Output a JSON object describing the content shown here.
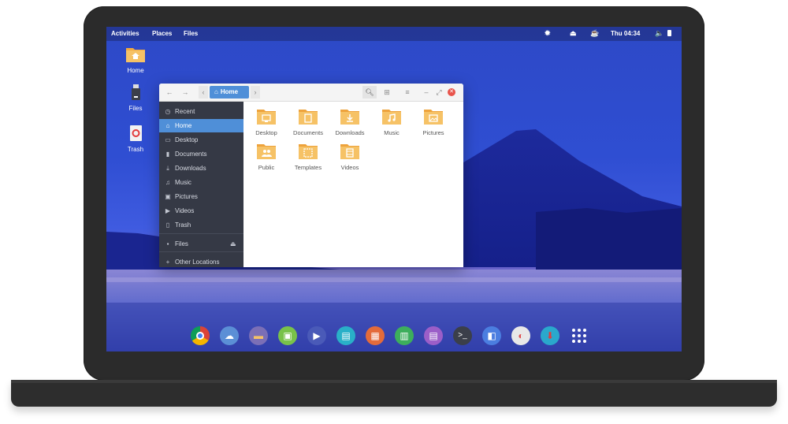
{
  "topbar": {
    "activities": "Activities",
    "places": "Places",
    "files": "Files",
    "clock": "Thu 04:34"
  },
  "desktop_icons": [
    {
      "label": "Home",
      "icon": "home-folder-icon"
    },
    {
      "label": "Files",
      "icon": "usb-drive-icon"
    },
    {
      "label": "Trash",
      "icon": "trash-icon"
    }
  ],
  "file_manager": {
    "breadcrumb": "Home",
    "sidebar": [
      {
        "label": "Recent",
        "icon": "clock-icon"
      },
      {
        "label": "Home",
        "icon": "home-icon",
        "active": true
      },
      {
        "label": "Desktop",
        "icon": "desktop-icon"
      },
      {
        "label": "Documents",
        "icon": "document-icon"
      },
      {
        "label": "Downloads",
        "icon": "download-icon"
      },
      {
        "label": "Music",
        "icon": "music-icon"
      },
      {
        "label": "Pictures",
        "icon": "picture-icon"
      },
      {
        "label": "Videos",
        "icon": "video-icon"
      },
      {
        "label": "Trash",
        "icon": "trash-icon"
      },
      {
        "label": "Files",
        "icon": "drive-icon"
      },
      {
        "label": "Other Locations",
        "icon": "plus-icon"
      }
    ],
    "folders": [
      {
        "label": "Desktop",
        "icon": "desktop-folder-icon"
      },
      {
        "label": "Documents",
        "icon": "documents-folder-icon"
      },
      {
        "label": "Downloads",
        "icon": "downloads-folder-icon"
      },
      {
        "label": "Music",
        "icon": "music-folder-icon"
      },
      {
        "label": "Pictures",
        "icon": "pictures-folder-icon"
      },
      {
        "label": "Public",
        "icon": "public-folder-icon"
      },
      {
        "label": "Templates",
        "icon": "templates-folder-icon"
      },
      {
        "label": "Videos",
        "icon": "videos-folder-icon"
      }
    ]
  },
  "dock": [
    {
      "icon": "chrome-icon",
      "color": "#ffffff"
    },
    {
      "icon": "cloud-icon",
      "color": "#5b8fd6"
    },
    {
      "icon": "files-icon",
      "color": "#7b6fb6"
    },
    {
      "icon": "image-viewer-icon",
      "color": "#79c24a"
    },
    {
      "icon": "media-player-icon",
      "color": "#4a5ab8"
    },
    {
      "icon": "text-editor-icon",
      "color": "#29b0c8"
    },
    {
      "icon": "presentation-icon",
      "color": "#e46b3a"
    },
    {
      "icon": "spreadsheet-icon",
      "color": "#3dae5c"
    },
    {
      "icon": "writer-icon",
      "color": "#9b5ec8"
    },
    {
      "icon": "terminal-icon",
      "color": "#3b3f4a"
    },
    {
      "icon": "toggle-icon",
      "color": "#4b7ee0"
    },
    {
      "icon": "settings-icon",
      "color": "#e8e8e8"
    },
    {
      "icon": "software-center-icon",
      "color": "#2aa8cc"
    },
    {
      "icon": "app-grid-icon",
      "color": "#ffffff"
    }
  ]
}
